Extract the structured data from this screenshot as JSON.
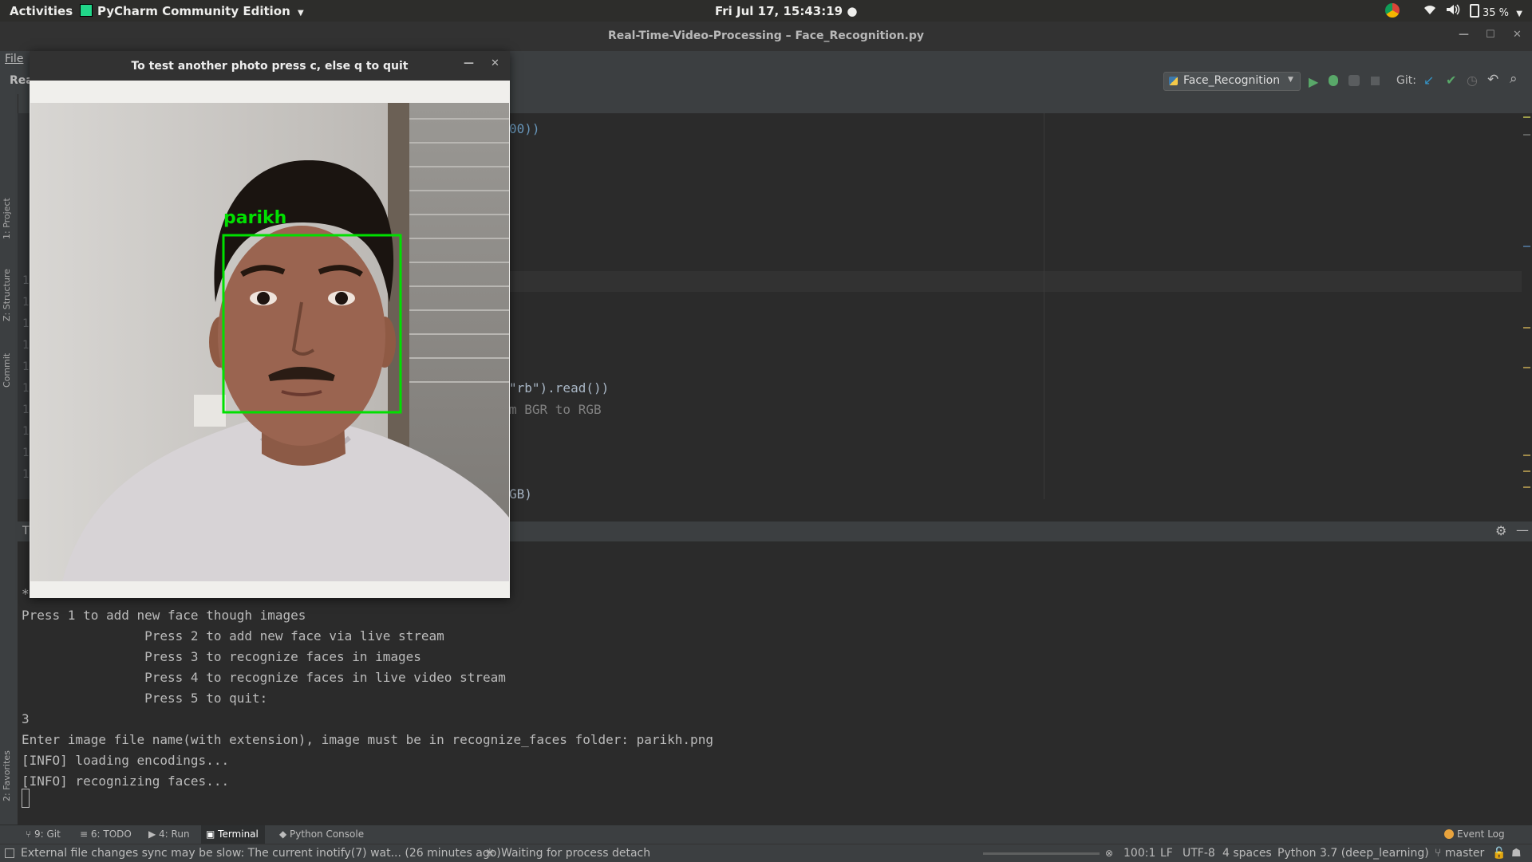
{
  "topbar": {
    "activities": "Activities",
    "app_name": "PyCharm Community Edition",
    "clock": "Fri Jul 17, 15:43:19",
    "battery": "35 %"
  },
  "window": {
    "title": "Real-Time-Video-Processing – Face_Recognition.py"
  },
  "menubar": {
    "file": "File"
  },
  "toolbar": {
    "project_label": "Rea",
    "run_config": "Face_Recognition",
    "git_label": "Git:"
  },
  "sidebar": {
    "project": "1: Project",
    "structure": "Z: Structure",
    "commit": "Commit",
    "favorites": "2: Favorites"
  },
  "editor": {
    "gutter_numbers": [
      "1",
      "1",
      "1",
      "1",
      "1",
      "1",
      "1",
      "1",
      "1",
      "1"
    ],
    "visible_code": [
      {
        "text": "00))"
      },
      {
        "text": "\"rb\").read())"
      },
      {
        "text": "m BGR to RGB"
      },
      {
        "text": "GB)"
      }
    ]
  },
  "terminal": {
    "tab_label": "T",
    "partial_line": "*",
    "lines": [
      "Press 1 to add new face though images",
      "\t\tPress 2 to add new face via live stream",
      "\t\tPress 3 to recognize faces in images",
      "\t\tPress 4 to recognize faces in live video stream",
      "\t\tPress 5 to quit:",
      "3",
      "Enter image file name(with extension), image must be in recognize_faces folder: parikh.png",
      "[INFO] loading encodings...",
      "[INFO] recognizing faces..."
    ]
  },
  "tool_tabs": [
    {
      "label": "9: Git"
    },
    {
      "label": "6: TODO"
    },
    {
      "label": "4: Run"
    },
    {
      "label": "Terminal"
    },
    {
      "label": "Python Console"
    }
  ],
  "event_log": "Event Log",
  "status": {
    "message": "External file changes sync may be slow: The current inotify(7) wat... (26 minutes ago)",
    "process": "Waiting for process detach",
    "position": "100:1",
    "line_sep": "LF",
    "encoding": "UTF-8",
    "indent": "4 spaces",
    "interpreter": "Python 3.7 (deep_learning)",
    "branch": "master"
  },
  "cv_window": {
    "title": "To test another photo press c, else q to quit",
    "face_label": "parikh",
    "box_color": "#00e000"
  }
}
